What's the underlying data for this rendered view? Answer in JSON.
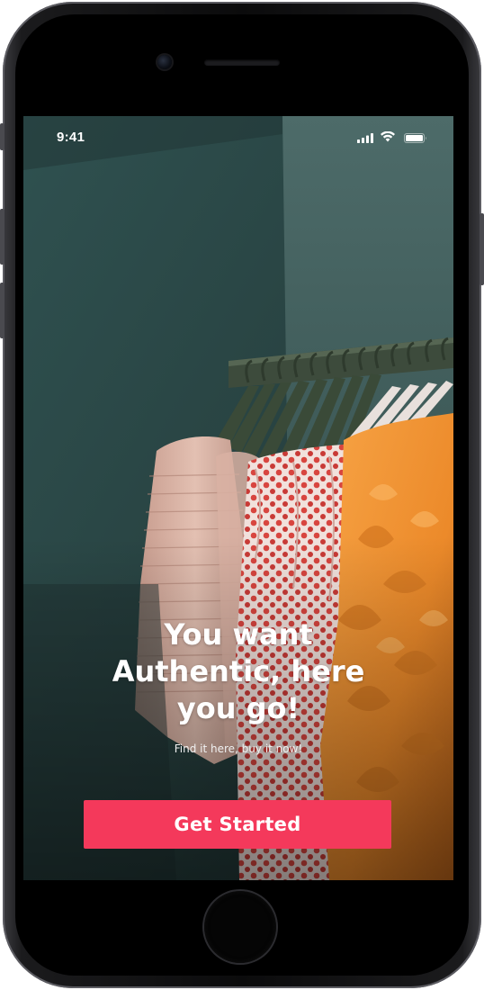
{
  "status_bar": {
    "time": "9:41",
    "icons": [
      "signal-icon",
      "wifi-icon",
      "battery-icon"
    ]
  },
  "onboarding": {
    "headline_line1": "You want",
    "headline_line2": "Authentic, here",
    "headline_line3": "you go!",
    "subtitle": "Find it here, buy it now!",
    "cta_label": "Get Started"
  },
  "colors": {
    "accent": "#f4395b",
    "background_teal": "#2c4a48"
  }
}
